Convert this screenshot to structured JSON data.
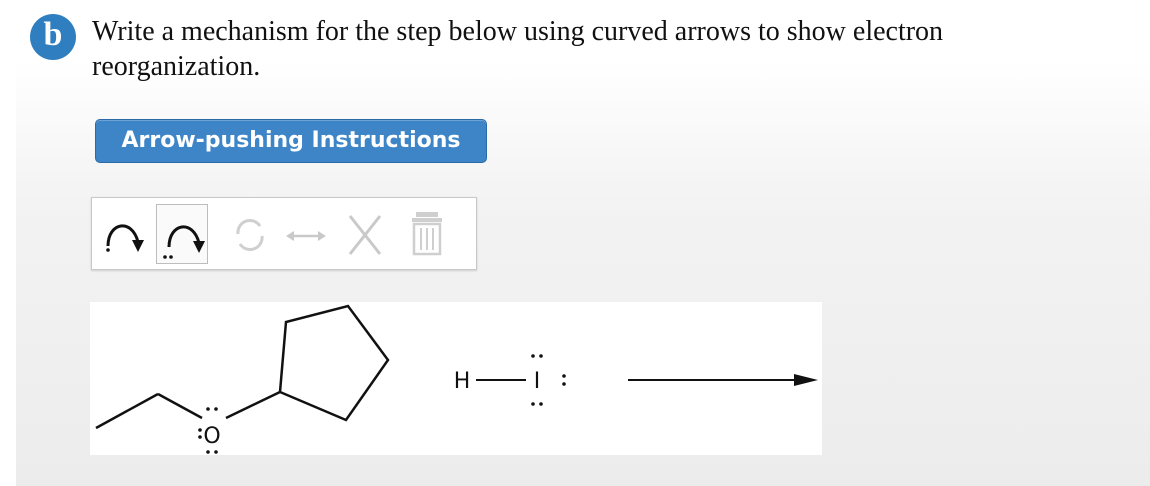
{
  "question": {
    "badge": "b",
    "text": "Write a mechanism for the step below using curved arrows to show electron reorganization."
  },
  "instructions_button": {
    "label": "Arrow-pushing Instructions"
  },
  "toolbar": {
    "tools": [
      {
        "icon": "curved-arrow-icon",
        "state": "enabled"
      },
      {
        "icon": "curved-arrow-electron-pair-icon",
        "state": "selected"
      },
      {
        "icon": "circular-arrows-icon",
        "state": "disabled"
      },
      {
        "icon": "double-arrow-icon",
        "state": "disabled"
      },
      {
        "icon": "close-x-icon",
        "state": "disabled"
      },
      {
        "icon": "trash-icon",
        "state": "disabled"
      }
    ]
  },
  "reaction": {
    "reagent": {
      "atom_h": "H",
      "atom_i": "I"
    },
    "ether_oxygen": "O"
  }
}
